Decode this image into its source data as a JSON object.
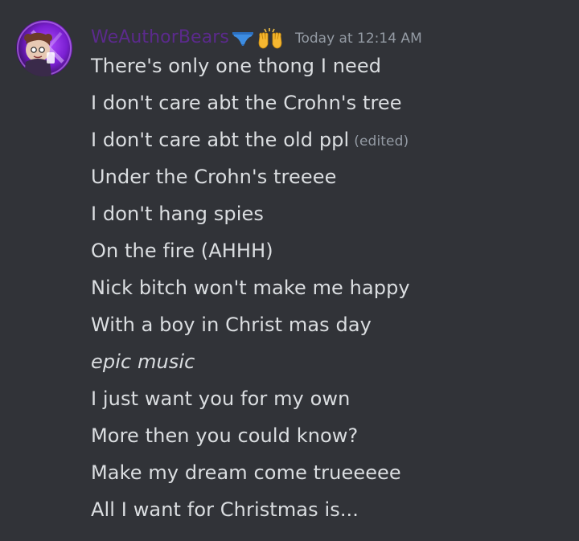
{
  "message": {
    "author": {
      "username": "WeAuthorBears",
      "emoji_1": "briefs-emoji",
      "emoji_2": "raising-hands-emoji",
      "avatar": "avatar"
    },
    "timestamp": "Today at 12:14 AM",
    "edited_label": "(edited)",
    "lines": [
      "There's only one thong I need",
      "I don't care abt the Crohn's tree",
      "I don't care abt the old ppl",
      "Under the Crohn's treeee",
      "I don't hang spies",
      "On the fire (AHHH)",
      "Nick bitch won't make me happy",
      "With a boy in Christ mas day",
      "epic music",
      "I just want you for my own",
      "More then you could know?",
      "Make my dream come trueeeee",
      "All I want for Christmas is..."
    ]
  },
  "colors": {
    "background": "#313338",
    "username": "#5b2a8c",
    "text": "#dbdee1",
    "muted": "#949ba4"
  }
}
